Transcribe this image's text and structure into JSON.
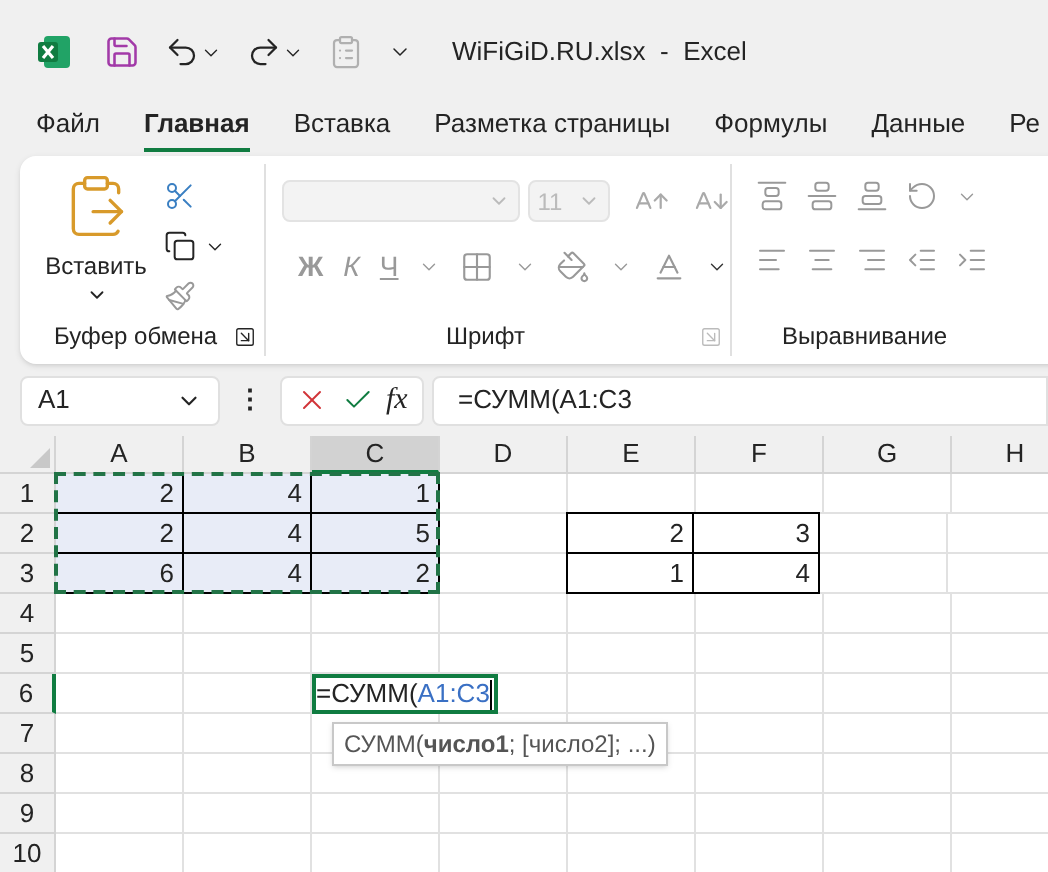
{
  "title_bar": {
    "file_name": "WiFiGiD.RU.xlsx",
    "separator": "-",
    "app": "Excel"
  },
  "menu_tabs": [
    {
      "label": "Файл",
      "selected": false
    },
    {
      "label": "Главная",
      "selected": true
    },
    {
      "label": "Вставка",
      "selected": false
    },
    {
      "label": "Разметка страницы",
      "selected": false
    },
    {
      "label": "Формулы",
      "selected": false
    },
    {
      "label": "Данные",
      "selected": false
    },
    {
      "label": "Ре",
      "selected": false
    }
  ],
  "ribbon": {
    "paste_label": "Вставить",
    "font_size": "11",
    "bold": "Ж",
    "italic": "К",
    "underline": "Ч",
    "groups": [
      {
        "label": "Буфер обмена"
      },
      {
        "label": "Шрифт"
      },
      {
        "label": "Выравнивание"
      }
    ]
  },
  "formula_bar": {
    "name_box": "A1",
    "more": "⋮",
    "function_label": "fx",
    "formula": "=СУММ(A1:C3"
  },
  "sheet": {
    "columns": [
      {
        "label": "A",
        "selected": false
      },
      {
        "label": "B",
        "selected": false
      },
      {
        "label": "C",
        "selected": true
      },
      {
        "label": "D",
        "selected": false
      },
      {
        "label": "E",
        "selected": false
      },
      {
        "label": "F",
        "selected": false
      },
      {
        "label": "G",
        "selected": false
      },
      {
        "label": "H",
        "selected": false
      }
    ],
    "rows": [
      {
        "header": "1",
        "selected": false,
        "cells": [
          {
            "value": "2",
            "highlighted": true
          },
          {
            "value": "4",
            "highlighted": true
          },
          {
            "value": "1",
            "highlighted": true
          },
          null,
          null,
          null,
          null,
          null
        ]
      },
      {
        "header": "2",
        "selected": false,
        "cells": [
          {
            "value": "2",
            "highlighted": true
          },
          {
            "value": "4",
            "highlighted": true
          },
          {
            "value": "5",
            "highlighted": true
          },
          null,
          {
            "value": "2",
            "bordered": true
          },
          {
            "value": "3",
            "bordered": true
          },
          null,
          null
        ]
      },
      {
        "header": "3",
        "selected": false,
        "cells": [
          {
            "value": "6",
            "highlighted": true
          },
          {
            "value": "4",
            "highlighted": true
          },
          {
            "value": "2",
            "highlighted": true
          },
          null,
          {
            "value": "1",
            "bordered": true
          },
          {
            "value": "4",
            "bordered": true
          },
          null,
          null
        ]
      },
      {
        "header": "4",
        "selected": false
      },
      {
        "header": "5",
        "selected": false
      },
      {
        "header": "6",
        "selected": true,
        "cells": [
          null,
          null,
          {
            "kind": "editing",
            "prefix": "=СУММ(",
            "reference": "A1:C3"
          },
          null,
          null,
          null,
          null,
          null
        ]
      },
      {
        "header": "7",
        "selected": false
      },
      {
        "header": "8",
        "selected": false
      },
      {
        "header": "9",
        "selected": false
      },
      {
        "header": "10",
        "selected": false
      }
    ],
    "tooltip": "СУММ(**число1**; [число2]; ...)"
  }
}
